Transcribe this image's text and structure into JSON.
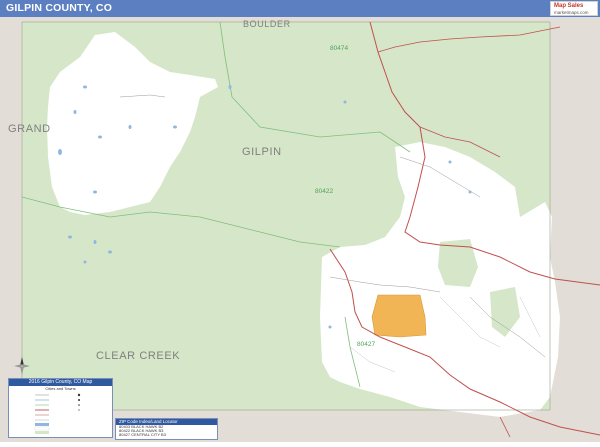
{
  "header": {
    "title": "GILPIN COUNTY, CO"
  },
  "logo": {
    "name": "Map Sales",
    "tagline": "marketmaps.com"
  },
  "map": {
    "county_labels": {
      "boulder": "BOULDER",
      "grand": "GRAND",
      "gilpin": "GILPIN",
      "clear_creek": "CLEAR CREEK"
    },
    "zip_labels": {
      "z80474": "80474",
      "z80422": "80422",
      "z80427": "80427"
    },
    "colors": {
      "surrounding": "#e2ddd6",
      "county": "#d6e6c8",
      "urban": "#ffffff",
      "city_highlight": "#f2b555",
      "road": "#c0504d",
      "water": "#8fb8e0",
      "zip_boundary": "#7fbf7f"
    }
  },
  "legend": {
    "title": "2016 Gilpin County, CO Map",
    "subtitle": "Cities and Towns",
    "rows": [
      {
        "label": "County",
        "mark": "Blackhawk",
        "town": "Central City"
      },
      {
        "label": "Rivers",
        "mark": "City",
        "town": "Town of 1,000"
      },
      {
        "label": "ZIP Code",
        "mark": "Village",
        "town": "Town of 500"
      },
      {
        "label": "Primary Roads",
        "mark": "Park",
        "town": "Town of 100"
      },
      {
        "label": "Secondary Roads",
        "mark": "",
        "town": ""
      },
      {
        "label": "Minor Roads",
        "mark": "",
        "town": ""
      },
      {
        "label": "Water Features",
        "mark": "",
        "town": ""
      },
      {
        "label": "Urban Area",
        "mark": "",
        "town": ""
      },
      {
        "label": "Parks",
        "mark": "",
        "town": ""
      }
    ]
  },
  "zip_locator": {
    "title": "ZIP Code Index/Land Locator",
    "rows": [
      {
        "zip": "80403",
        "name": "BLACK HAWK",
        "grid": "B2"
      },
      {
        "zip": "80422",
        "name": "BLACK HAWK",
        "grid": "B3"
      },
      {
        "zip": "80427",
        "name": "CENTRAL CITY",
        "grid": "B3"
      },
      {
        "zip": "80474",
        "name": "ROLLINSVILLE",
        "grid": "B1"
      }
    ]
  },
  "compass": {
    "label": "N"
  }
}
